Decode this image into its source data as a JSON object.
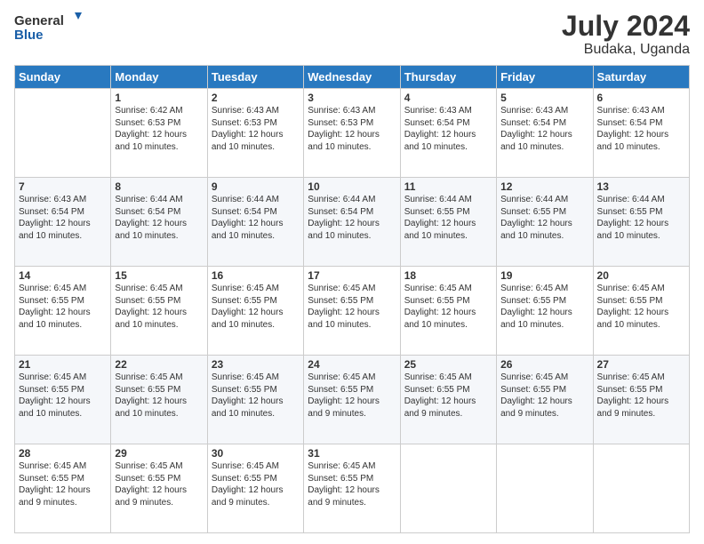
{
  "logo": {
    "line1": "General",
    "line2": "Blue"
  },
  "title": {
    "month_year": "July 2024",
    "location": "Budaka, Uganda"
  },
  "days_of_week": [
    "Sunday",
    "Monday",
    "Tuesday",
    "Wednesday",
    "Thursday",
    "Friday",
    "Saturday"
  ],
  "weeks": [
    [
      {
        "day": "",
        "sunrise": "",
        "sunset": "",
        "daylight": ""
      },
      {
        "day": "1",
        "sunrise": "6:42 AM",
        "sunset": "6:53 PM",
        "daylight": "12 hours and 10 minutes."
      },
      {
        "day": "2",
        "sunrise": "6:43 AM",
        "sunset": "6:53 PM",
        "daylight": "12 hours and 10 minutes."
      },
      {
        "day": "3",
        "sunrise": "6:43 AM",
        "sunset": "6:53 PM",
        "daylight": "12 hours and 10 minutes."
      },
      {
        "day": "4",
        "sunrise": "6:43 AM",
        "sunset": "6:54 PM",
        "daylight": "12 hours and 10 minutes."
      },
      {
        "day": "5",
        "sunrise": "6:43 AM",
        "sunset": "6:54 PM",
        "daylight": "12 hours and 10 minutes."
      },
      {
        "day": "6",
        "sunrise": "6:43 AM",
        "sunset": "6:54 PM",
        "daylight": "12 hours and 10 minutes."
      }
    ],
    [
      {
        "day": "7",
        "sunrise": "6:43 AM",
        "sunset": "6:54 PM",
        "daylight": "12 hours and 10 minutes."
      },
      {
        "day": "8",
        "sunrise": "6:44 AM",
        "sunset": "6:54 PM",
        "daylight": "12 hours and 10 minutes."
      },
      {
        "day": "9",
        "sunrise": "6:44 AM",
        "sunset": "6:54 PM",
        "daylight": "12 hours and 10 minutes."
      },
      {
        "day": "10",
        "sunrise": "6:44 AM",
        "sunset": "6:54 PM",
        "daylight": "12 hours and 10 minutes."
      },
      {
        "day": "11",
        "sunrise": "6:44 AM",
        "sunset": "6:55 PM",
        "daylight": "12 hours and 10 minutes."
      },
      {
        "day": "12",
        "sunrise": "6:44 AM",
        "sunset": "6:55 PM",
        "daylight": "12 hours and 10 minutes."
      },
      {
        "day": "13",
        "sunrise": "6:44 AM",
        "sunset": "6:55 PM",
        "daylight": "12 hours and 10 minutes."
      }
    ],
    [
      {
        "day": "14",
        "sunrise": "6:45 AM",
        "sunset": "6:55 PM",
        "daylight": "12 hours and 10 minutes."
      },
      {
        "day": "15",
        "sunrise": "6:45 AM",
        "sunset": "6:55 PM",
        "daylight": "12 hours and 10 minutes."
      },
      {
        "day": "16",
        "sunrise": "6:45 AM",
        "sunset": "6:55 PM",
        "daylight": "12 hours and 10 minutes."
      },
      {
        "day": "17",
        "sunrise": "6:45 AM",
        "sunset": "6:55 PM",
        "daylight": "12 hours and 10 minutes."
      },
      {
        "day": "18",
        "sunrise": "6:45 AM",
        "sunset": "6:55 PM",
        "daylight": "12 hours and 10 minutes."
      },
      {
        "day": "19",
        "sunrise": "6:45 AM",
        "sunset": "6:55 PM",
        "daylight": "12 hours and 10 minutes."
      },
      {
        "day": "20",
        "sunrise": "6:45 AM",
        "sunset": "6:55 PM",
        "daylight": "12 hours and 10 minutes."
      }
    ],
    [
      {
        "day": "21",
        "sunrise": "6:45 AM",
        "sunset": "6:55 PM",
        "daylight": "12 hours and 10 minutes."
      },
      {
        "day": "22",
        "sunrise": "6:45 AM",
        "sunset": "6:55 PM",
        "daylight": "12 hours and 10 minutes."
      },
      {
        "day": "23",
        "sunrise": "6:45 AM",
        "sunset": "6:55 PM",
        "daylight": "12 hours and 10 minutes."
      },
      {
        "day": "24",
        "sunrise": "6:45 AM",
        "sunset": "6:55 PM",
        "daylight": "12 hours and 9 minutes."
      },
      {
        "day": "25",
        "sunrise": "6:45 AM",
        "sunset": "6:55 PM",
        "daylight": "12 hours and 9 minutes."
      },
      {
        "day": "26",
        "sunrise": "6:45 AM",
        "sunset": "6:55 PM",
        "daylight": "12 hours and 9 minutes."
      },
      {
        "day": "27",
        "sunrise": "6:45 AM",
        "sunset": "6:55 PM",
        "daylight": "12 hours and 9 minutes."
      }
    ],
    [
      {
        "day": "28",
        "sunrise": "6:45 AM",
        "sunset": "6:55 PM",
        "daylight": "12 hours and 9 minutes."
      },
      {
        "day": "29",
        "sunrise": "6:45 AM",
        "sunset": "6:55 PM",
        "daylight": "12 hours and 9 minutes."
      },
      {
        "day": "30",
        "sunrise": "6:45 AM",
        "sunset": "6:55 PM",
        "daylight": "12 hours and 9 minutes."
      },
      {
        "day": "31",
        "sunrise": "6:45 AM",
        "sunset": "6:55 PM",
        "daylight": "12 hours and 9 minutes."
      },
      {
        "day": "",
        "sunrise": "",
        "sunset": "",
        "daylight": ""
      },
      {
        "day": "",
        "sunrise": "",
        "sunset": "",
        "daylight": ""
      },
      {
        "day": "",
        "sunrise": "",
        "sunset": "",
        "daylight": ""
      }
    ]
  ],
  "labels": {
    "sunrise_prefix": "Sunrise: ",
    "sunset_prefix": "Sunset: ",
    "daylight_prefix": "Daylight: "
  }
}
